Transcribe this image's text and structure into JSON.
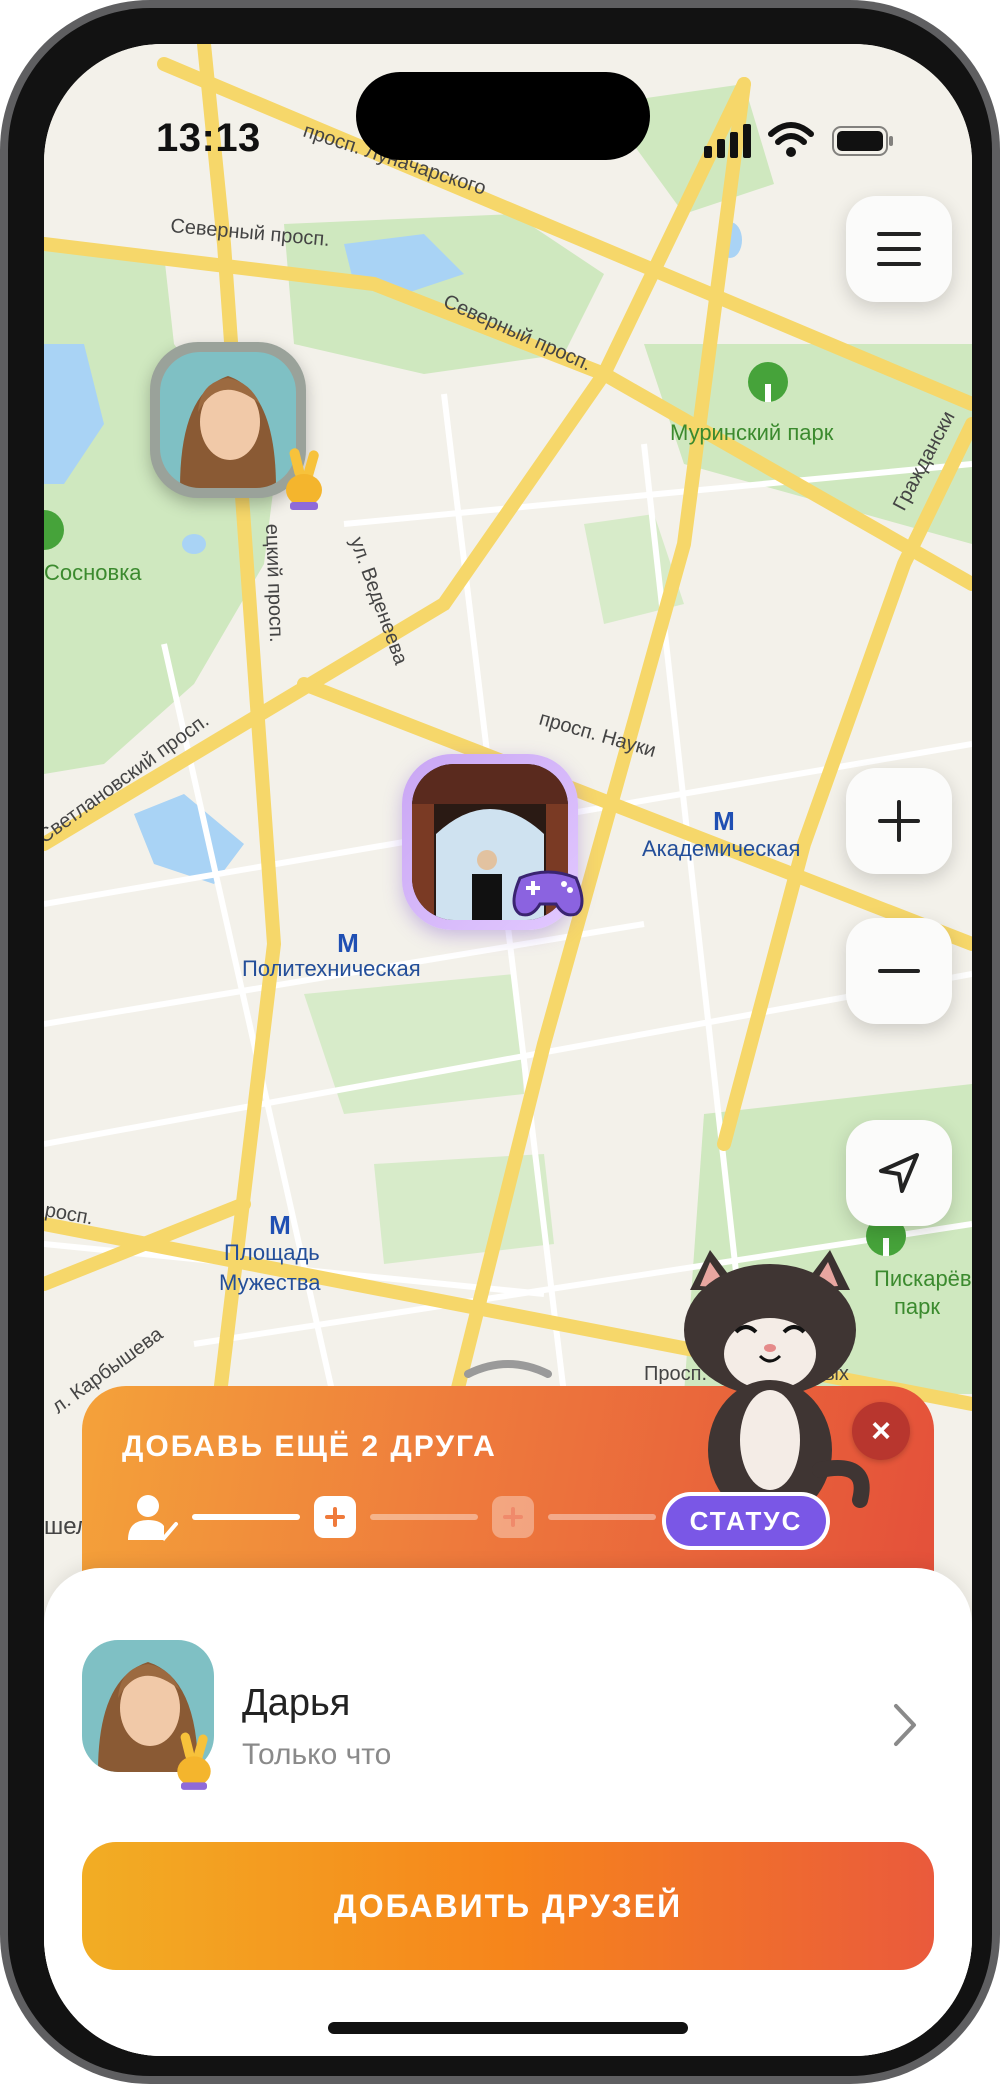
{
  "status_bar": {
    "time": "13:13"
  },
  "map": {
    "labels": {
      "lunacharskogo": "просп. Луначарского",
      "severny_1": "Северный просп.",
      "severny_2": "Северный просп.",
      "murinsky_park": "Муринский парк",
      "grazhdansky": "Граждански",
      "sosnovka": "Сосновка",
      "engels": "ецкий просп.",
      "vedeneeva": "ул. Веденеева",
      "svetlanovsky": "Светлановский просп.",
      "nauki": "просп. Науки",
      "akademicheskaya": "Академическая",
      "politekhnicheskaya": "Политехническая",
      "ploshchad_muzhestva_1": "Площадь",
      "ploshchad_muzhestva_2": "Мужества",
      "prosp_left": "росп.",
      "karbysheva": "л. Карбышева",
      "piskarevsky_1": "Пискарёвский",
      "piskarevsky_2": "парк",
      "prosp_bottom": "Просп. Непокорённых",
      "partial_left": "шел"
    },
    "metro_icon": "metro-m-icon",
    "park_icon": "tree-icon"
  },
  "controls": {
    "menu_icon": "hamburger-icon",
    "zoom_in_icon": "plus-icon",
    "zoom_out_icon": "minus-icon",
    "locate_icon": "navigation-arrow-icon"
  },
  "banner": {
    "title": "ДОБАВЬ ЕЩЁ 2 ДРУГА",
    "status_label": "СТАТУС",
    "close_label": "×",
    "step_icons": [
      "user-check-icon",
      "plus-icon",
      "plus-icon"
    ],
    "progress_completed_steps": 1,
    "progress_total_steps": 3
  },
  "friend": {
    "name": "Дарья",
    "time": "Только что",
    "badge_icon": "victory-hand-icon"
  },
  "map_friend_badges": [
    "victory-hand-icon",
    "gamepad-icon"
  ],
  "add_friends_label": "ДОБАВИТЬ ДРУЗЕЙ",
  "colors": {
    "banner_start": "#f4a23a",
    "banner_end": "#e4503a",
    "status_pill": "#7a57e6",
    "button_start": "#f2ad24",
    "button_end": "#ea5a3c",
    "road": "#f6d76a",
    "park": "#cfe8bf"
  }
}
